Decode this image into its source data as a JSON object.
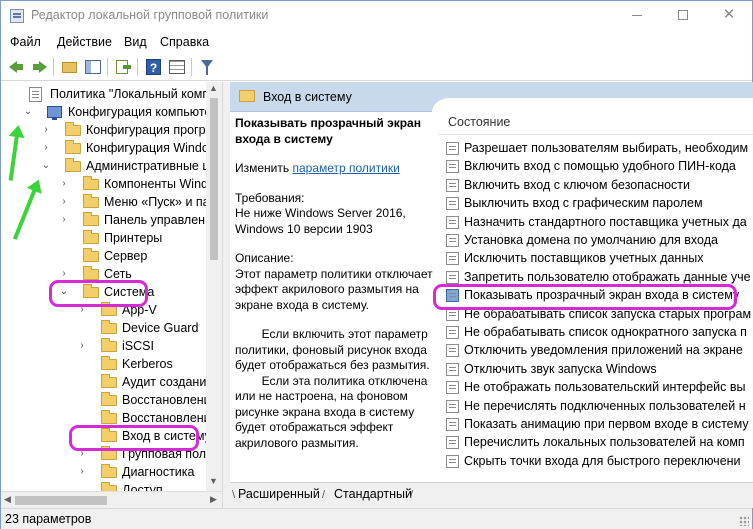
{
  "window": {
    "title": "Редактор локальной групповой политики",
    "colors": {
      "accent": "#c9d9ec",
      "highlight": "#d62ad6",
      "arrow": "#39d439",
      "link": "#1a5fb4"
    }
  },
  "menu": {
    "file": "Файл",
    "action": "Действие",
    "view": "Вид",
    "help": "Справка"
  },
  "toolbar": {
    "icons": [
      "back-arrow-icon",
      "forward-arrow-icon",
      "up-folder-icon",
      "show-hide-tree-icon",
      "export-list-icon",
      "help-icon",
      "properties-grid-icon",
      "filter-icon"
    ]
  },
  "tree": {
    "items": [
      {
        "label": "Политика \"Локальный компьют",
        "icon": "policy-icon",
        "chevron": ""
      },
      {
        "label": "Конфигурация компьютера",
        "icon": "computer-icon",
        "chevron": "⌄"
      },
      {
        "label": "Конфигурация программ",
        "icon": "folder-icon",
        "chevron": "›"
      },
      {
        "label": "Конфигурация Windows",
        "icon": "folder-icon",
        "chevron": "›"
      },
      {
        "label": "Административные шабл",
        "icon": "folder-icon",
        "chevron": "⌄"
      },
      {
        "label": "Компоненты Windows",
        "icon": "folder-icon",
        "chevron": "›"
      },
      {
        "label": "Меню «Пуск» и панел",
        "icon": "folder-icon",
        "chevron": "›"
      },
      {
        "label": "Панель управления",
        "icon": "folder-icon",
        "chevron": "›"
      },
      {
        "label": "Принтеры",
        "icon": "folder-icon",
        "chevron": ""
      },
      {
        "label": "Сервер",
        "icon": "folder-icon",
        "chevron": ""
      },
      {
        "label": "Сеть",
        "icon": "folder-icon",
        "chevron": "›"
      },
      {
        "label": "Система",
        "icon": "folder-icon",
        "chevron": "⌄"
      },
      {
        "label": "App-V",
        "icon": "folder-icon",
        "chevron": "›"
      },
      {
        "label": "Device Guard",
        "icon": "folder-icon",
        "chevron": ""
      },
      {
        "label": "iSCSI",
        "icon": "folder-icon",
        "chevron": "›"
      },
      {
        "label": "Kerberos",
        "icon": "folder-icon",
        "chevron": ""
      },
      {
        "label": "Аудит создания пр",
        "icon": "folder-icon",
        "chevron": ""
      },
      {
        "label": "Восстановление",
        "icon": "folder-icon",
        "chevron": ""
      },
      {
        "label": "Восстановление с",
        "icon": "folder-icon",
        "chevron": ""
      },
      {
        "label": "Вход в систему",
        "icon": "folder-icon",
        "chevron": ""
      },
      {
        "label": "Групповая полити",
        "icon": "folder-icon",
        "chevron": "›"
      },
      {
        "label": "Диагностика",
        "icon": "folder-icon",
        "chevron": "›"
      },
      {
        "label": "Доступ",
        "icon": "folder-icon",
        "chevron": ""
      }
    ]
  },
  "right_pane": {
    "header": "Вход в систему",
    "desc": {
      "title": "Показывать прозрачный экран входа в систему",
      "edit_prefix": "Изменить ",
      "edit_link": "параметр политики",
      "requirements_label": "Требования:",
      "requirements_text": "Не ниже Windows Server 2016, Windows 10 версии 1903",
      "description_label": "Описание:",
      "description_text": "Этот параметр политики отключает эффект акрилового размытия на экране входа в систему.",
      "para_enabled": "        Если включить этот параметр политики, фоновый рисунок входа будет отображаться без размытия.",
      "para_disabled": "        Если эта политика отключена или не настроена, на фоновом рисунке экрана входа в систему будет отображаться эффект акрилового размытия."
    },
    "settings": {
      "column_header": "Состояние",
      "items": [
        "Разрешает пользователям выбирать, необходим",
        "Включить вход с помощью удобного ПИН-кода",
        "Включить вход с ключом безопасности",
        "Выключить вход с графическим паролем",
        "Назначить стандартного поставщика учетных да",
        "Установка домена по умолчанию для входа",
        "Исключить поставщиков учетных данных",
        "Запретить пользователю отображать данные уче",
        "Показывать прозрачный экран входа в систему",
        "Не обрабатывать список запуска старых програм",
        "Не обрабатывать список однократного запуска п",
        "Отключить уведомления приложений на экране",
        "Отключить звук запуска Windows",
        "Не отображать пользовательский интерфейс вы",
        "Не перечислять подключенных пользователей н",
        "Показать анимацию при первом входе в систему",
        "Перечислить локальных пользователей на комп",
        "Скрыть точки входа для быстрого переключени"
      ]
    },
    "tabs": {
      "extended": "Расширенный",
      "standard": "Стандартный"
    }
  },
  "status": {
    "text": "23 параметров"
  }
}
